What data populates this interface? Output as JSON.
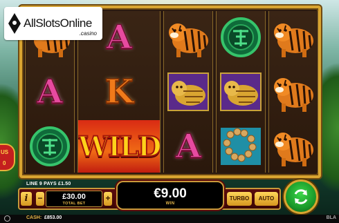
{
  "logo": {
    "text": "AllSlotsOnline",
    "sub": ".casino"
  },
  "reels": [
    [
      "tiger",
      "letter-a",
      "jade-coin"
    ],
    [
      "letter-a",
      "letter-k",
      "wild"
    ],
    [
      "tiger",
      "armor-tiger",
      "letter-a"
    ],
    [
      "jade-coin",
      "armor-tiger",
      "bead-bracelet"
    ],
    [
      "tiger",
      "tiger",
      "tiger"
    ]
  ],
  "symbols": {
    "letter-a": "A",
    "letter-k": "K",
    "wild": "WILD"
  },
  "bonus_tab": {
    "label": "US",
    "count": "0"
  },
  "line_pays": "LINE 9 PAYS £1.50",
  "controls": {
    "info": "i",
    "minus": "−",
    "plus": "+",
    "total_bet_value": "£30.00",
    "total_bet_label": "TOTAL BET",
    "win_value": "€9.00",
    "win_label": "WIN",
    "turbo": "TURBO",
    "auto": "AUTO"
  },
  "status": {
    "cash_label": "CASH:",
    "cash_value": "£853.00",
    "brand": "BLA"
  },
  "colors": {
    "frame_gold": "#d9a531",
    "panel_red": "#5b0d0d",
    "spin_green": "#1a9a2a",
    "wild_red": "#d92b14"
  }
}
